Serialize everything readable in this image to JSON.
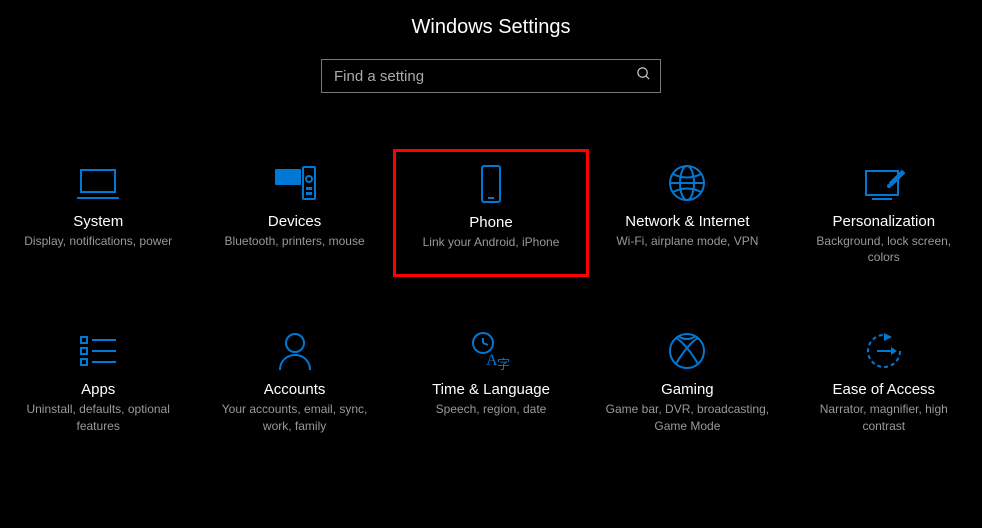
{
  "header": {
    "title": "Windows Settings"
  },
  "search": {
    "placeholder": "Find a setting",
    "value": ""
  },
  "tiles": [
    {
      "id": "system",
      "title": "System",
      "desc": "Display, notifications, power"
    },
    {
      "id": "devices",
      "title": "Devices",
      "desc": "Bluetooth, printers, mouse"
    },
    {
      "id": "phone",
      "title": "Phone",
      "desc": "Link your Android, iPhone",
      "highlighted": true
    },
    {
      "id": "network",
      "title": "Network & Internet",
      "desc": "Wi-Fi, airplane mode, VPN"
    },
    {
      "id": "personalization",
      "title": "Personalization",
      "desc": "Background, lock screen, colors"
    },
    {
      "id": "apps",
      "title": "Apps",
      "desc": "Uninstall, defaults, optional features"
    },
    {
      "id": "accounts",
      "title": "Accounts",
      "desc": "Your accounts, email, sync, work, family"
    },
    {
      "id": "time-language",
      "title": "Time & Language",
      "desc": "Speech, region, date"
    },
    {
      "id": "gaming",
      "title": "Gaming",
      "desc": "Game bar, DVR, broadcasting, Game Mode"
    },
    {
      "id": "ease-of-access",
      "title": "Ease of Access",
      "desc": "Narrator, magnifier, high contrast"
    }
  ],
  "accent_color": "#0078d4",
  "highlight_color": "#ff0000"
}
